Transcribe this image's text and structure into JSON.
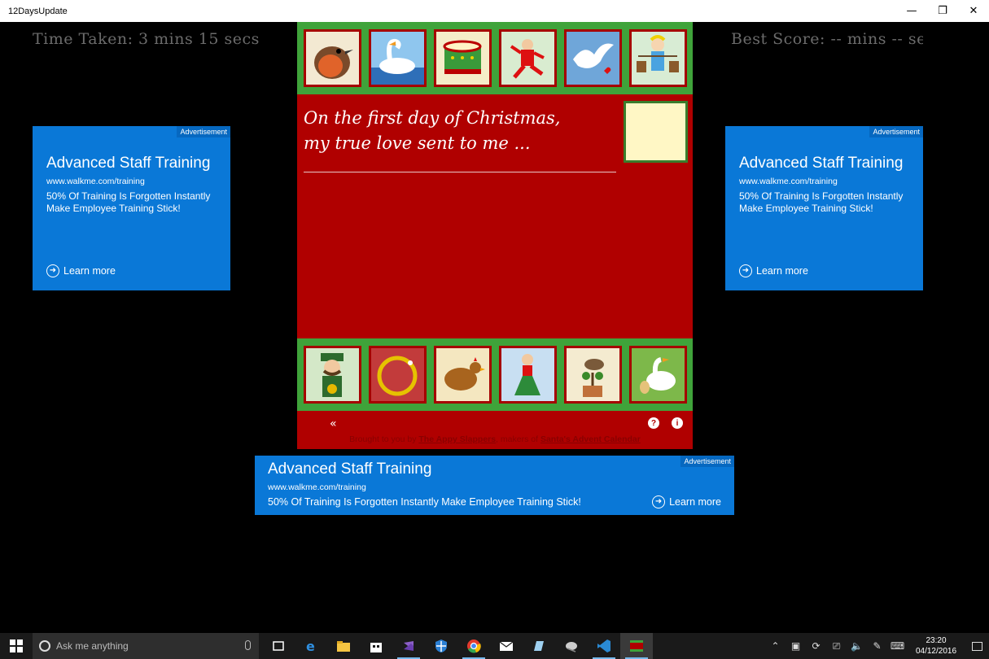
{
  "window": {
    "title": "12DaysUpdate",
    "minimize": "—",
    "restore": "❐",
    "close": "✕"
  },
  "game": {
    "time_taken": "Time Taken: 3 mins 15 secs",
    "best_score": "Best Score: -- mins -- secs",
    "verse_line1": "On the first day of Christmas,",
    "verse_line2": "my true love sent to me ...",
    "top_tiles": [
      "robin-tile",
      "swan-tile",
      "drum-tile",
      "leaping-lord-tile",
      "dove-tile",
      "milkmaid-tile"
    ],
    "bottom_tiles": [
      "piper-tile",
      "gold-ring-tile",
      "hen-tile",
      "dancing-lady-tile",
      "partridge-tile",
      "goose-tile"
    ],
    "back_icon": "«",
    "help_icon": "?",
    "info_icon": "i",
    "credits_prefix": "Brought to you by ",
    "credits_company": "The Appy Slappers",
    "credits_mid": ", makers of ",
    "credits_product": "Santa's Advent Calendar"
  },
  "ads": {
    "badge": "Advertisement",
    "headline": "Advanced Staff Training",
    "url": "www.walkme.com/training",
    "desc_side": "50% Of Training Is Forgotten Instantly Make Employee Training Stick!",
    "desc_bottom": "50% Of Training Is Forgotten Instantly Make Employee Training Stick!",
    "learn_more": "Learn more"
  },
  "taskbar": {
    "search_placeholder": "Ask me anything",
    "apps": [
      "task-view-icon",
      "edge-icon",
      "file-explorer-icon",
      "store-icon",
      "visual-studio-icon",
      "defender-icon",
      "chrome-icon",
      "mail-icon",
      "notepad-icon",
      "app-icon",
      "vscode-icon",
      "twelve-days-app-icon"
    ],
    "time": "23:20",
    "date": "04/12/2016"
  },
  "colors": {
    "board_red": "#b00000",
    "strip_green": "#3fa33a",
    "ad_blue": "#0a78d7",
    "drop_box": "#fff7c5"
  }
}
